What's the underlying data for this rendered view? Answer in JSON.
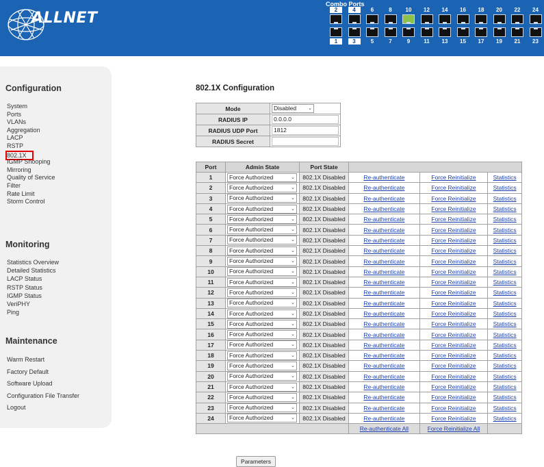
{
  "header": {
    "brand": "ALLNET",
    "combo_label": "Combo Ports",
    "top_ports": [
      "2",
      "4",
      "6",
      "8",
      "10",
      "12",
      "14",
      "16",
      "18",
      "20",
      "22",
      "24"
    ],
    "bottom_ports": [
      "1",
      "3",
      "5",
      "7",
      "9",
      "11",
      "13",
      "15",
      "17",
      "19",
      "21",
      "23"
    ],
    "lit_port": "10"
  },
  "sidebar": {
    "configuration": {
      "title": "Configuration",
      "items": [
        "System",
        "Ports",
        "VLANs",
        "Aggregation",
        "LACP",
        "RSTP",
        "802.1X",
        "IGMP Snooping",
        "Mirroring",
        "Quality of Service",
        "Filter",
        "Rate Limit",
        "Storm Control"
      ],
      "active": "802.1X"
    },
    "monitoring": {
      "title": "Monitoring",
      "items": [
        "Statistics Overview",
        "Detailed Statistics",
        "LACP Status",
        "RSTP Status",
        "IGMP Status",
        "VeriPHY",
        "Ping"
      ]
    },
    "maintenance": {
      "title": "Maintenance",
      "items": [
        "Warm Restart",
        "Factory Default",
        "Software Upload",
        "Configuration File Transfer",
        "Logout"
      ]
    }
  },
  "main": {
    "title": "802.1X Configuration",
    "config": {
      "mode_label": "Mode",
      "mode_value": "Disabled",
      "radius_ip_label": "RADIUS IP",
      "radius_ip_value": "0.0.0.0",
      "radius_port_label": "RADIUS UDP Port",
      "radius_port_value": "1812",
      "radius_secret_label": "RADIUS Secret",
      "radius_secret_value": ""
    },
    "table": {
      "headers": {
        "port": "Port",
        "admin": "Admin State",
        "state": "Port State"
      },
      "admin_state": "Force Authorized",
      "port_state": "802.1X Disabled",
      "reauth": "Re-authenticate",
      "reinit": "Force Reinitialize",
      "stats": "Statistics",
      "ports": [
        "1",
        "2",
        "3",
        "4",
        "5",
        "6",
        "7",
        "8",
        "9",
        "10",
        "11",
        "12",
        "13",
        "14",
        "15",
        "16",
        "17",
        "18",
        "19",
        "20",
        "21",
        "22",
        "23",
        "24"
      ],
      "reauth_all": "Re-authenticate All",
      "reinit_all": "Force Reinitialize All"
    },
    "parameters_button": "Parameters"
  }
}
